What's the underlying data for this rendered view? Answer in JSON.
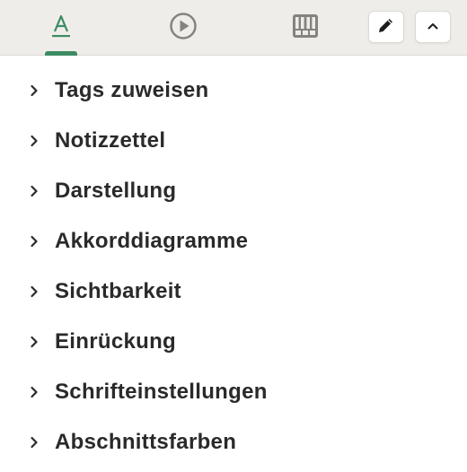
{
  "toolbar": {
    "tabs": [
      {
        "icon": "text-format-icon",
        "active": true
      },
      {
        "icon": "play-circle-icon",
        "active": false
      },
      {
        "icon": "piano-icon",
        "active": false
      }
    ],
    "edit_icon": "pencil-icon",
    "collapse_icon": "chevron-up-icon",
    "accent_color": "#3d8b63"
  },
  "menu": {
    "items": [
      {
        "label": "Tags zuweisen"
      },
      {
        "label": "Notizzettel"
      },
      {
        "label": "Darstellung"
      },
      {
        "label": "Akkorddiagramme"
      },
      {
        "label": "Sichtbarkeit"
      },
      {
        "label": "Einrückung"
      },
      {
        "label": "Schrifteinstellungen"
      },
      {
        "label": "Abschnittsfarben"
      }
    ]
  }
}
